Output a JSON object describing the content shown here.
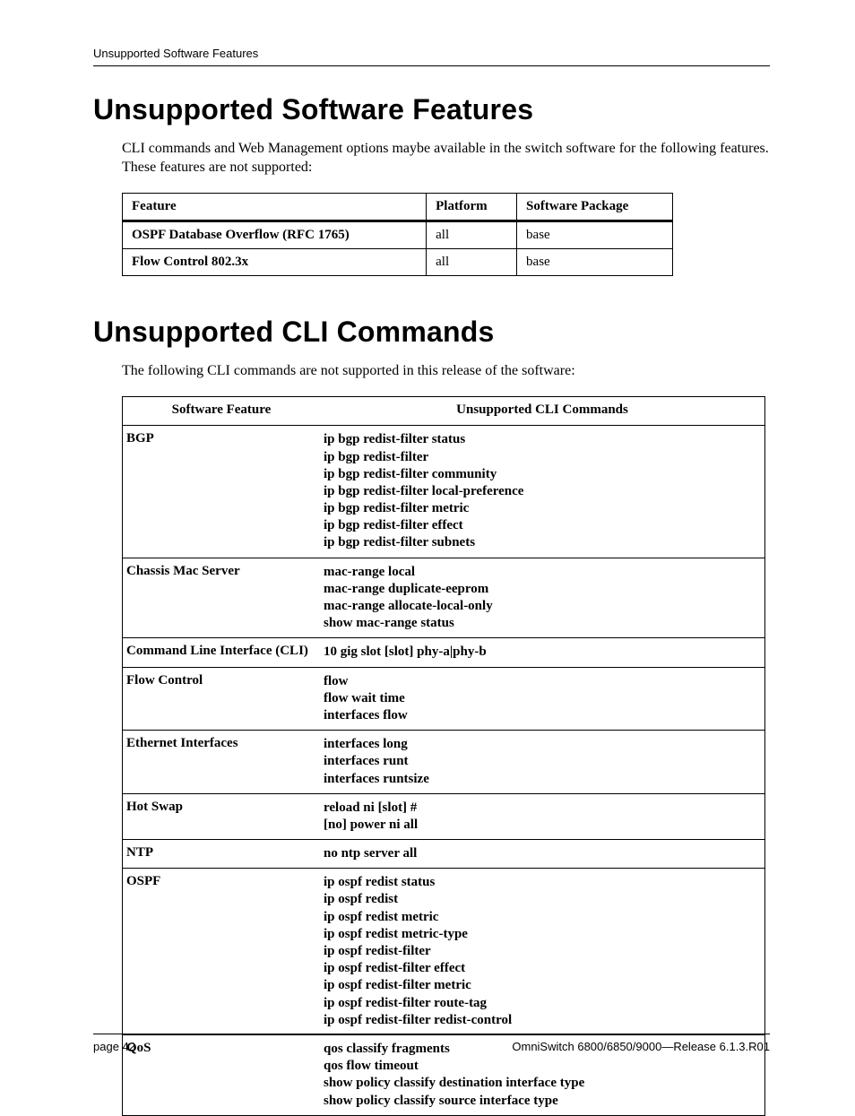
{
  "running_head": "Unsupported Software Features",
  "section1": {
    "title": "Unsupported Software Features",
    "intro": "CLI commands and Web Management options maybe available in the switch software for the following features. These features are not supported:",
    "table": {
      "headers": {
        "c0": "Feature",
        "c1": "Platform",
        "c2": "Software Package"
      },
      "rows": [
        {
          "c0": "OSPF Database Overflow (RFC 1765)",
          "c1": "all",
          "c2": "base"
        },
        {
          "c0": "Flow Control 802.3x",
          "c1": "all",
          "c2": "base"
        }
      ]
    }
  },
  "section2": {
    "title": "Unsupported CLI Commands",
    "intro": "The following CLI commands are not supported in this release of the software:",
    "table": {
      "headers": {
        "c0": "Software Feature",
        "c1": "Unsupported CLI Commands"
      },
      "rows": [
        {
          "feature": "BGP",
          "cmds": [
            "ip bgp redist-filter status",
            "ip bgp redist-filter",
            "ip bgp redist-filter community",
            "ip bgp redist-filter local-preference",
            "ip bgp redist-filter metric",
            "ip bgp redist-filter effect",
            "ip bgp redist-filter subnets"
          ]
        },
        {
          "feature": "Chassis Mac Server",
          "cmds": [
            "mac-range local",
            "mac-range duplicate-eeprom",
            "mac-range allocate-local-only",
            "show mac-range status"
          ]
        },
        {
          "feature": "Command Line Interface (CLI)",
          "cmds": [
            "10 gig slot [slot] phy-a|phy-b"
          ]
        },
        {
          "feature": "Flow Control",
          "cmds": [
            "flow",
            "flow wait time",
            "interfaces flow"
          ]
        },
        {
          "feature": "Ethernet Interfaces",
          "cmds": [
            "interfaces long",
            "interfaces runt",
            "interfaces runtsize"
          ]
        },
        {
          "feature": "Hot Swap",
          "cmds": [
            "reload ni [slot] #",
            "[no] power ni all"
          ]
        },
        {
          "feature": "NTP",
          "cmds": [
            "no ntp server all"
          ]
        },
        {
          "feature": "OSPF",
          "cmds": [
            "ip ospf redist status",
            "ip ospf redist",
            "ip ospf redist metric",
            "ip ospf redist metric-type",
            "ip ospf redist-filter",
            "ip ospf redist-filter effect",
            "ip ospf redist-filter metric",
            "ip ospf redist-filter route-tag",
            "ip ospf redist-filter redist-control"
          ]
        },
        {
          "feature": "QoS",
          "cmds": [
            "qos classify fragments",
            "qos flow timeout",
            "show policy classify destination interface type",
            "show policy classify source interface type"
          ]
        }
      ]
    }
  },
  "footer": {
    "left": "page 42",
    "right": "OmniSwitch 6800/6850/9000—Release 6.1.3.R01"
  }
}
